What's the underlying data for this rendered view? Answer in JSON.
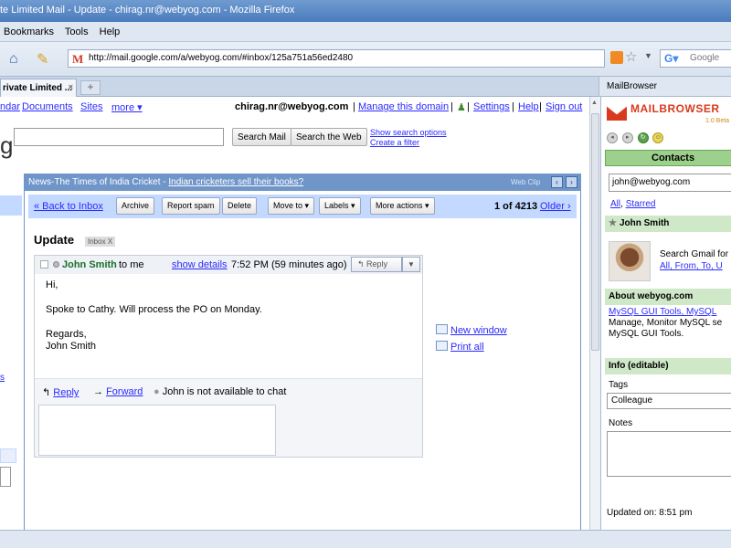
{
  "window": {
    "title": "te Limited Mail - Update - chirag.nr@webyog.com - Mozilla Firefox"
  },
  "menu": {
    "items": [
      "Bookmarks",
      "Tools",
      "Help"
    ]
  },
  "address": {
    "url": "http://mail.google.com/a/webyog.com/#inbox/125a751a56ed2480",
    "search_placeholder": "Google"
  },
  "tab": {
    "label": "rivate Limited ...",
    "close": "×",
    "new": "+"
  },
  "sidebar_title": "MailBrowser",
  "gmail": {
    "nav": {
      "calendar": "ndar",
      "documents": "Documents",
      "sites": "Sites",
      "more": "more ▾"
    },
    "user": {
      "email": "chirag.nr@webyog.com",
      "manage": "Manage this domain",
      "settings": "Settings",
      "help": "Help",
      "signout": "Sign out",
      "sep": "|"
    },
    "logo_fragment": "g",
    "search": {
      "mail_btn": "Search Mail",
      "web_btn": "Search the Web",
      "options": "Show search options",
      "filter": "Create a filter"
    }
  },
  "news": {
    "prefix": "News-The Times of India Cricket - ",
    "headline": "Indian cricketers sell their books?",
    "label": "Web Clip",
    "prev": "‹",
    "next": "›"
  },
  "toolbar": {
    "back": "« Back to Inbox",
    "archive": "Archive",
    "spam": "Report spam",
    "delete": "Delete",
    "moveto": "Move to ▾",
    "labels": "Labels ▾",
    "more": "More actions ▾",
    "count": "1 of 4213",
    "older": "Older ›"
  },
  "message": {
    "subject": "Update",
    "label": "Inbox",
    "label_close": "X",
    "sender": "John Smith",
    "to": "to me",
    "show_details": "show details",
    "time": "7:52 PM (59 minutes ago)",
    "reply_btn": "Reply",
    "dropdown": "▼",
    "body": [
      "Hi,",
      "Spoke to Cathy. Will process the PO on Monday.",
      "Regards,",
      "John Smith"
    ],
    "footer": {
      "reply": "Reply",
      "forward": "Forward",
      "chat_status": "John is not available to chat"
    }
  },
  "side_links": {
    "new_window": "New window",
    "print_all": "Print all"
  },
  "mailbrowser": {
    "brand": "MAILBROWSER",
    "version": "1.0 Beta",
    "contacts_tab": "Contacts",
    "email": "john@webyog.com",
    "filter_all": "All",
    "filter_starred": "Starred",
    "contact_name": "John Smith",
    "search_lines": [
      "Search Gmail for",
      "All, From, To, U"
    ],
    "about_header": "About webyog.com",
    "about_lines": [
      "MySQL GUI Tools, MySQL ",
      "Manage, Monitor MySQL se",
      "MySQL GUI Tools."
    ],
    "info_header": "Info (editable)",
    "tags_label": "Tags",
    "tags_value": "Colleague",
    "notes_label": "Notes",
    "updated": "Updated on: 8:51 pm"
  }
}
